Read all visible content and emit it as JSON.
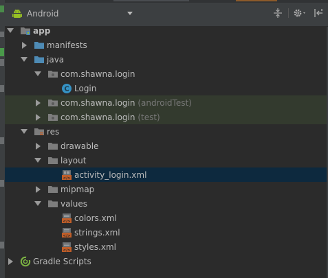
{
  "toolbar": {
    "view_label": "Android",
    "icons": [
      "android-icon",
      "dropdown-arrow-icon",
      "collapse-all-icon",
      "gear-icon",
      "hide-panel-icon"
    ]
  },
  "tree": {
    "app": "app",
    "manifests": "manifests",
    "java": "java",
    "pkg_main": "com.shawna.login",
    "login_class": "Login",
    "pkg_android_test": "com.shawna.login",
    "pkg_android_test_suffix": "(androidTest)",
    "pkg_test": "com.shawna.login",
    "pkg_test_suffix": "(test)",
    "res": "res",
    "drawable": "drawable",
    "layout": "layout",
    "activity_login": "activity_login.xml",
    "mipmap": "mipmap",
    "values": "values",
    "colors": "colors.xml",
    "strings": "strings.xml",
    "styles": "styles.xml",
    "gradle_scripts": "Gradle Scripts"
  },
  "colors": {
    "background": "#2b2b2b",
    "toolbar": "#3c3f41",
    "selection": "#0d293e",
    "test_highlight": "#333a2e",
    "folder_blue": "#4e8bb5",
    "android_green": "#97c024",
    "class_circle": "#3592c4",
    "xml_orange": "#c25e28"
  }
}
